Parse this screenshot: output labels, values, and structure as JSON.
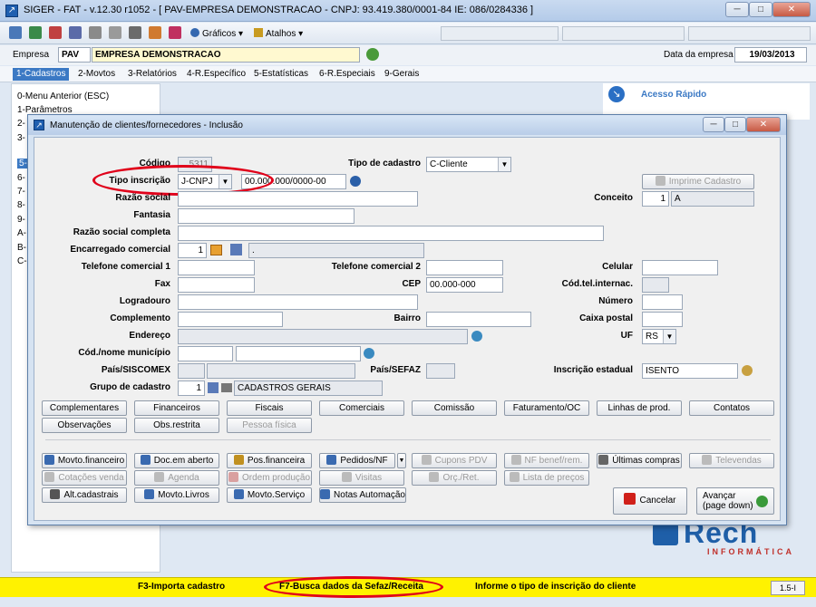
{
  "main_window": {
    "title": "SIGER - FAT - v.12.30 r1052 - [ PAV-EMPRESA DEMONSTRACAO - CNPJ: 93.419.380/0001-84 IE: 086/0284336 ]"
  },
  "toolbar": {
    "graficos": "Gráficos",
    "atalhos": "Atalhos"
  },
  "company": {
    "label": "Empresa",
    "code": "PAV",
    "name": "EMPRESA DEMONSTRACAO",
    "date_label": "Data da empresa",
    "date": "19/03/2013"
  },
  "menu": [
    "1-Cadastros",
    "2-Movtos",
    "3-Relatórios",
    "4-R.Específico",
    "5-Estatísticas",
    "6-R.Especiais",
    "9-Gerais"
  ],
  "left_panel": {
    "items": [
      "0-Menu Anterior (ESC)",
      "1-Parâmetros",
      "2-",
      "3-",
      "5-",
      "6-",
      "7-",
      "8-",
      "9-",
      "A-",
      "B-",
      "C-"
    ]
  },
  "quick_access": {
    "label": "Acesso Rápido"
  },
  "dialog": {
    "title": "Manutenção de clientes/fornecedores - Inclusão",
    "fields": {
      "codigo": {
        "label": "Código",
        "value": "5311"
      },
      "tipo_cadastro": {
        "label": "Tipo de cadastro",
        "value": "C-Cliente"
      },
      "tipo_inscricao": {
        "label": "Tipo inscrição",
        "value": "J-CNPJ",
        "mask": "00.000.000/0000-00"
      },
      "imprime_cadastro": "Imprime Cadastro",
      "razao_social": {
        "label": "Razão social"
      },
      "conceito": {
        "label": "Conceito",
        "value": "1",
        "desc": "A"
      },
      "fantasia": {
        "label": "Fantasia"
      },
      "razao_social_completa": {
        "label": "Razão social completa"
      },
      "encarregado": {
        "label": "Encarregado comercial",
        "value": "1",
        "desc": "."
      },
      "telefone1": {
        "label": "Telefone comercial 1"
      },
      "telefone2": {
        "label": "Telefone comercial 2"
      },
      "celular": {
        "label": "Celular"
      },
      "fax": {
        "label": "Fax"
      },
      "cep": {
        "label": "CEP",
        "value": "00.000-000"
      },
      "cod_tel": {
        "label": "Cód.tel.internac."
      },
      "logradouro": {
        "label": "Logradouro"
      },
      "numero": {
        "label": "Número"
      },
      "complemento": {
        "label": "Complemento"
      },
      "bairro": {
        "label": "Bairro"
      },
      "caixa_postal": {
        "label": "Caixa postal"
      },
      "endereco": {
        "label": "Endereço"
      },
      "uf": {
        "label": "UF",
        "value": "RS"
      },
      "municipio": {
        "label": "Cód./nome município"
      },
      "pais_siscomex": {
        "label": "País/SISCOMEX"
      },
      "pais_sefaz": {
        "label": "País/SEFAZ"
      },
      "inscricao_estadual": {
        "label": "Inscrição estadual",
        "value": "ISENTO"
      },
      "grupo": {
        "label": "Grupo de cadastro",
        "value": "1",
        "desc": "CADASTROS GERAIS"
      }
    },
    "tab_buttons": [
      "Complementares",
      "Financeiros",
      "Fiscais",
      "Comerciais",
      "Comissão",
      "Faturamento/OC",
      "Linhas de prod.",
      "Contatos",
      "Observações",
      "Obs.restrita",
      "Pessoa física"
    ],
    "action_buttons": {
      "row1": [
        "Movto.financeiro",
        "Doc.em aberto",
        "Pos.financeira",
        "Pedidos/NF",
        "Cupons PDV",
        "NF benef/rem.",
        "Últimas compras",
        "Televendas"
      ],
      "row2": [
        "Cotações venda",
        "Agenda",
        "Ordem produção",
        "Visitas",
        "Orç./Ret.",
        "Lista de preços"
      ],
      "row3": [
        "Alt.cadastrais",
        "Movto.Livros",
        "Movto.Serviço",
        "Notas Automação"
      ]
    },
    "cancel": "Cancelar",
    "next": "Avançar\n(page down)"
  },
  "brand": {
    "name": "Rech",
    "sub": "INFORMÁTICA"
  },
  "status": {
    "f3": "F3-Importa cadastro",
    "f7": "F7-Busca dados da Sefaz/Receita",
    "hint": "Informe o tipo de inscrição do cliente",
    "version": "1.5-I"
  },
  "colors": {
    "highlight": "#e0001a",
    "status_bg": "#fff200",
    "accent": "#3b79c4"
  }
}
